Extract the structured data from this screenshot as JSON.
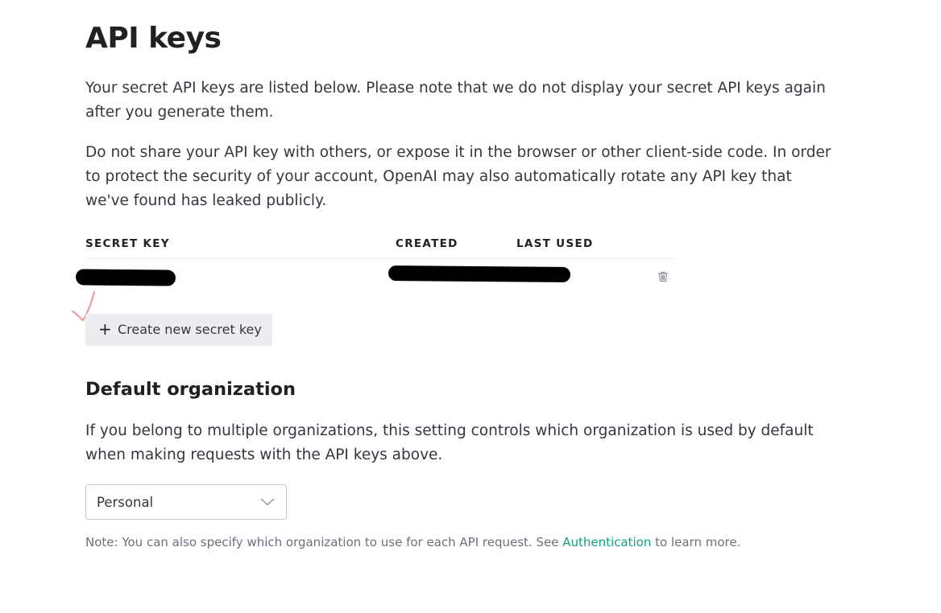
{
  "header": {
    "title": "API keys"
  },
  "intro": {
    "paragraph1": "Your secret API keys are listed below. Please note that we do not display your secret API keys again after you generate them.",
    "paragraph2": "Do not share your API key with others, or expose it in the browser or other client-side code. In order to protect the security of your account, OpenAI may also automatically rotate any API key that we've found has leaked publicly."
  },
  "keys_table": {
    "columns": [
      "SECRET KEY",
      "CREATED",
      "LAST USED"
    ],
    "rows": [
      {
        "secret_key": "[redacted]",
        "created": "[redacted]",
        "last_used": "[redacted]",
        "delete_icon": "trash-icon"
      }
    ]
  },
  "actions": {
    "create_label": "Create new secret key",
    "create_icon": "plus-icon"
  },
  "default_org": {
    "title": "Default organization",
    "description": "If you belong to multiple organizations, this setting controls which organization is used by default when making requests with the API keys above.",
    "selected": "Personal",
    "note_prefix": "Note: You can also specify which organization to use for each API request. See",
    "note_link": "Authentication",
    "note_suffix": "to learn more."
  },
  "colors": {
    "accent_link": "#10a37f",
    "button_bg": "#ececf1",
    "text_primary": "#353740",
    "text_heading": "#202123",
    "text_muted": "#6e6e80",
    "annotation_mark": "#e8a0a0"
  }
}
